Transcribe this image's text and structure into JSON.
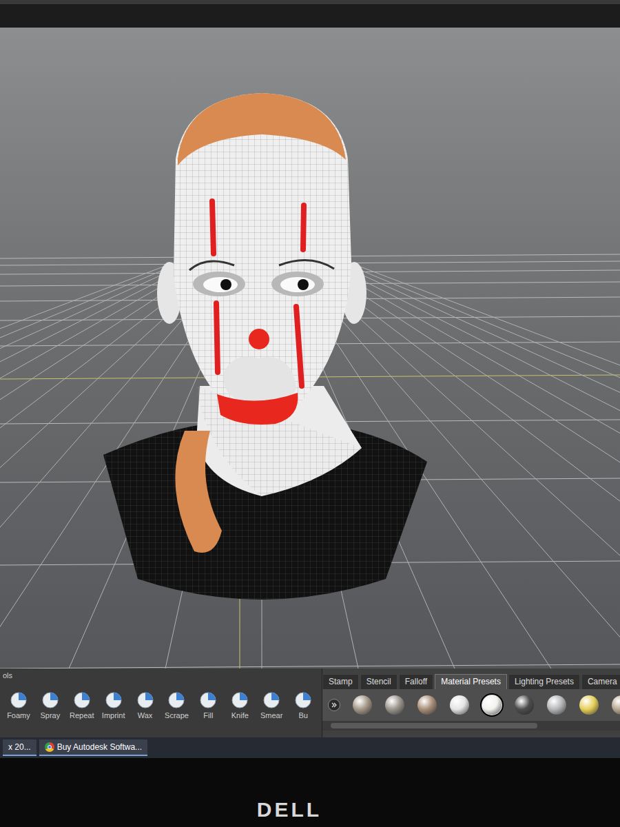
{
  "tools_panel": {
    "title": "ols",
    "tools": [
      {
        "label": "Foamy"
      },
      {
        "label": "Spray"
      },
      {
        "label": "Repeat"
      },
      {
        "label": "Imprint"
      },
      {
        "label": "Wax"
      },
      {
        "label": "Scrape"
      },
      {
        "label": "Fill"
      },
      {
        "label": "Knife"
      },
      {
        "label": "Smear"
      },
      {
        "label": "Bu"
      }
    ]
  },
  "tray_tabs": [
    {
      "label": "Stamp",
      "selected": false
    },
    {
      "label": "Stencil",
      "selected": false
    },
    {
      "label": "Falloff",
      "selected": false
    },
    {
      "label": "Material Presets",
      "selected": true
    },
    {
      "label": "Lighting Presets",
      "selected": false
    },
    {
      "label": "Camera",
      "selected": false
    }
  ],
  "material_presets": [
    {
      "selected": false,
      "color": "#a49888"
    },
    {
      "selected": false,
      "color": "#9a948c"
    },
    {
      "selected": false,
      "color": "#a88e78"
    },
    {
      "selected": false,
      "color": "#e4e4e4"
    },
    {
      "selected": true,
      "color": "#f2f2ee"
    },
    {
      "selected": false,
      "color": "#4c4c4c"
    },
    {
      "selected": false,
      "color": "#b4b6b8"
    },
    {
      "selected": false,
      "color": "#e6cf5a"
    },
    {
      "selected": false,
      "color": "#b8a890"
    }
  ],
  "taskbar": {
    "items": [
      {
        "label": "x 20...",
        "selected": false
      },
      {
        "label": "Buy Autodesk Softwa...",
        "selected": false
      }
    ]
  },
  "monitor": {
    "brand": "DELL"
  }
}
